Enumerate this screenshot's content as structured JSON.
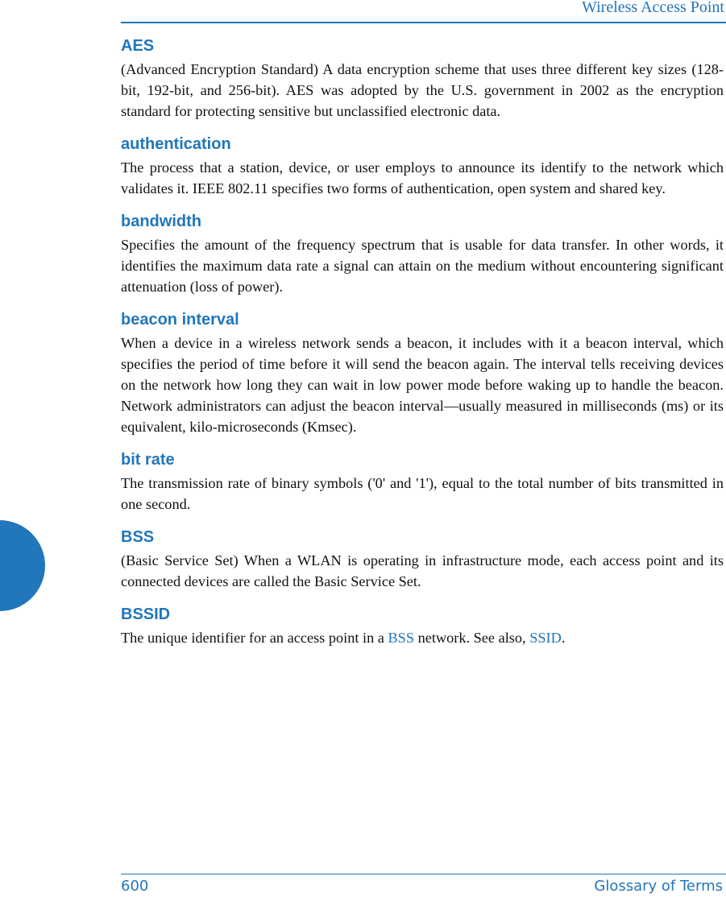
{
  "header": {
    "title": "Wireless Access Point"
  },
  "entries": [
    {
      "term": "AES",
      "definition": "(Advanced Encryption Standard) A data encryption scheme that uses three different key sizes (128-bit, 192-bit, and 256-bit). AES was adopted by the U.S. government in 2002 as the encryption standard for protecting sensitive but unclassified electronic data."
    },
    {
      "term": "authentication",
      "definition": "The process that a station, device, or user employs to announce its identify to the network which validates it. IEEE 802.11 specifies two forms of authentication, open system and shared key."
    },
    {
      "term": "bandwidth",
      "definition": "Specifies the amount of the frequency spectrum that is usable for data transfer. In other words, it identifies the maximum data rate a signal can attain on the medium without encountering significant attenuation (loss of power)."
    },
    {
      "term": "beacon interval",
      "definition": "When a device in a wireless network sends a beacon, it includes with it a beacon interval, which specifies the period of time before it will send the beacon again. The interval tells receiving devices on the network how long they can wait in low power mode before waking up to handle the beacon. Network administrators can adjust the beacon interval—usually measured in milliseconds (ms) or its equivalent, kilo-microseconds (Kmsec)."
    },
    {
      "term": "bit rate",
      "definition": "The transmission rate of binary symbols ('0' and '1'), equal to the total number of bits transmitted in one second."
    },
    {
      "term": "BSS",
      "definition": "(Basic Service Set) When a WLAN is operating in infrastructure mode, each access point and its connected devices are called the Basic Service Set."
    },
    {
      "term": "BSSID",
      "definition_parts": {
        "before": "The unique identifier for an access point in a ",
        "link1": "BSS",
        "middle": " network. See also, ",
        "link2": "SSID",
        "after": "."
      }
    }
  ],
  "footer": {
    "page_number": "600",
    "section": "Glossary of Terms"
  },
  "colors": {
    "accent": "#2176bc",
    "text": "#111111"
  }
}
